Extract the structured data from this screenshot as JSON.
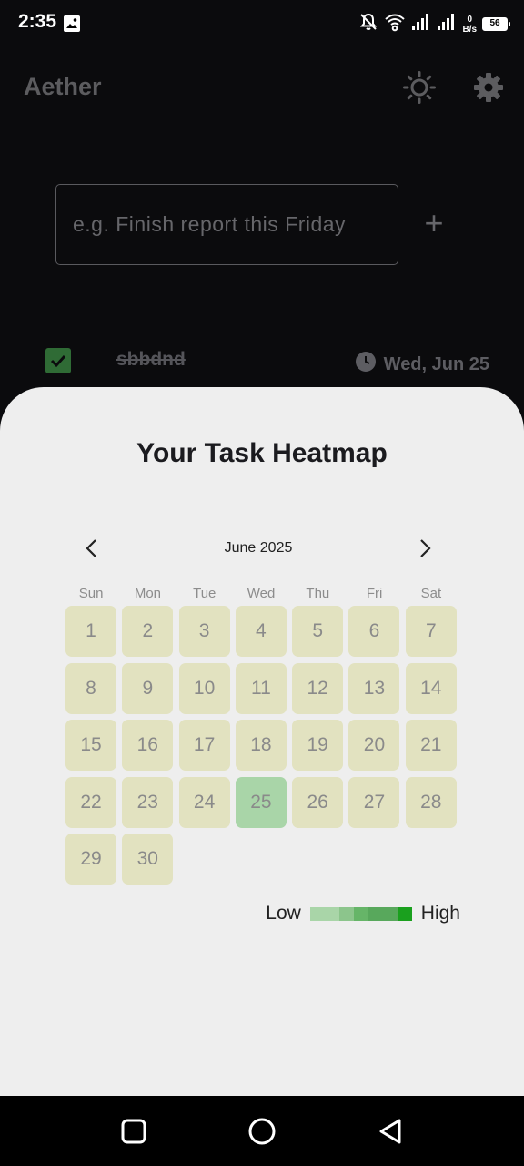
{
  "status_bar": {
    "time": "2:35",
    "net_speed_value": "0",
    "net_speed_unit": "B/s",
    "battery": "56"
  },
  "app": {
    "title": "Aether"
  },
  "input": {
    "placeholder": "e.g. Finish report this Friday",
    "value": ""
  },
  "add_label": "+",
  "task": {
    "title": "sbbdnd",
    "completed": true,
    "date": "Wed, Jun 25"
  },
  "sheet": {
    "title": "Your Task Heatmap",
    "month": "June 2025",
    "weekdays": [
      "Sun",
      "Mon",
      "Tue",
      "Wed",
      "Thu",
      "Fri",
      "Sat"
    ],
    "days": [
      "1",
      "2",
      "3",
      "4",
      "5",
      "6",
      "7",
      "8",
      "9",
      "10",
      "11",
      "12",
      "13",
      "14",
      "15",
      "16",
      "17",
      "18",
      "19",
      "20",
      "21",
      "22",
      "23",
      "24",
      "25",
      "26",
      "27",
      "28",
      "29",
      "30"
    ],
    "highlighted_day": "25",
    "legend": {
      "low": "Low",
      "high": "High",
      "colors": [
        "#a9d5a8",
        "#8cc58c",
        "#66b568",
        "#58a85c",
        "#1aa01e"
      ]
    }
  },
  "colors": {
    "cell": "#e2e2c0",
    "cell_active": "#a9d5a8",
    "check": "#2f6b35"
  }
}
